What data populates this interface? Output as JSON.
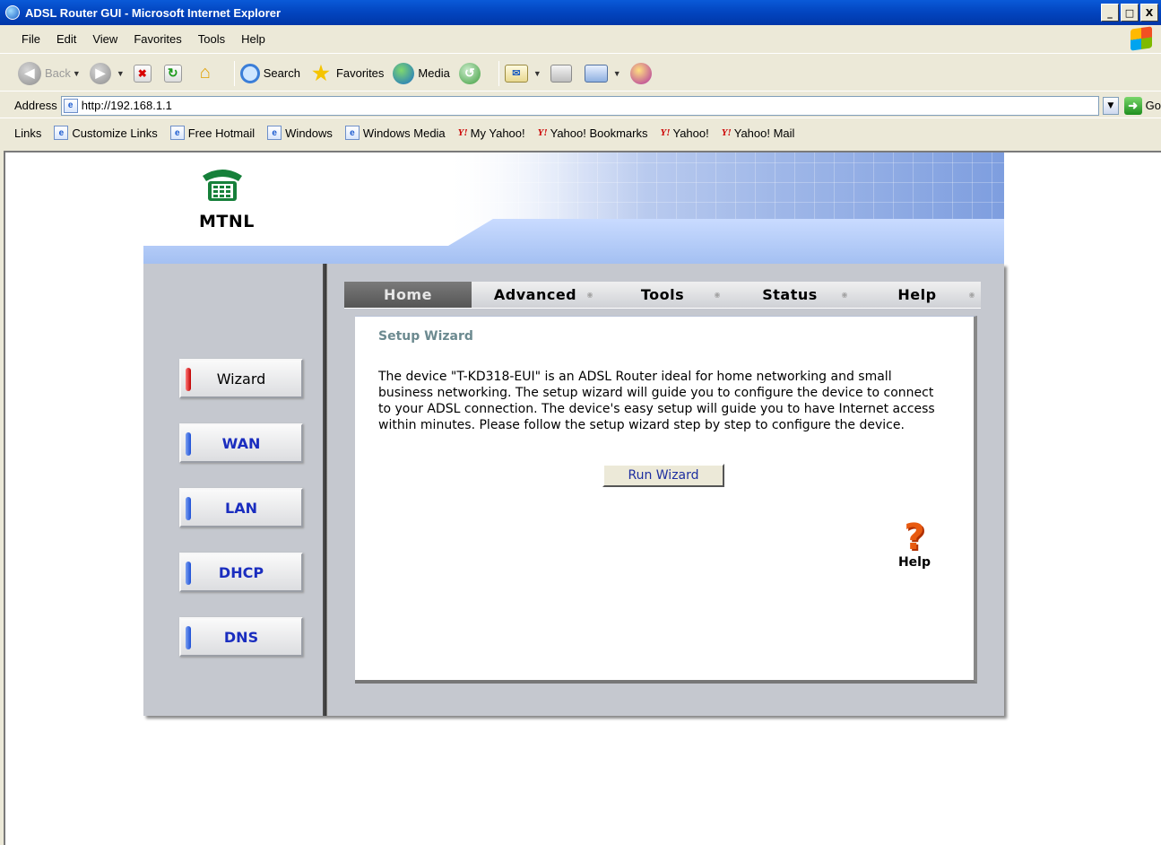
{
  "window": {
    "title": "ADSL Router GUI - Microsoft Internet Explorer",
    "minimize": "_",
    "maximize": "□",
    "close": "X"
  },
  "menu": {
    "items": [
      {
        "label": "File"
      },
      {
        "label": "Edit"
      },
      {
        "label": "View"
      },
      {
        "label": "Favorites"
      },
      {
        "label": "Tools"
      },
      {
        "label": "Help"
      }
    ]
  },
  "toolbar": {
    "back": "Back",
    "search": "Search",
    "favorites": "Favorites",
    "media": "Media"
  },
  "address": {
    "label": "Address",
    "url": "http://192.168.1.1",
    "go": "Go"
  },
  "links": {
    "label": "Links",
    "items": [
      {
        "label": "Customize Links",
        "icon": "ie-page-icon"
      },
      {
        "label": "Free Hotmail",
        "icon": "ie-page-icon"
      },
      {
        "label": "Windows",
        "icon": "ie-page-icon"
      },
      {
        "label": "Windows Media",
        "icon": "ie-page-icon"
      },
      {
        "label": "My Yahoo!",
        "icon": "yahoo-icon"
      },
      {
        "label": "Yahoo! Bookmarks",
        "icon": "yahoo-icon"
      },
      {
        "label": "Yahoo!",
        "icon": "yahoo-icon"
      },
      {
        "label": "Yahoo! Mail",
        "icon": "yahoo-icon"
      }
    ]
  },
  "router": {
    "logo_text": "MTNL",
    "tabs": [
      {
        "label": "Home",
        "active": true
      },
      {
        "label": "Advanced",
        "active": false
      },
      {
        "label": "Tools",
        "active": false
      },
      {
        "label": "Status",
        "active": false
      },
      {
        "label": "Help",
        "active": false
      }
    ],
    "sidebar": [
      {
        "label": "Wizard",
        "active": true
      },
      {
        "label": "WAN",
        "active": false
      },
      {
        "label": "LAN",
        "active": false
      },
      {
        "label": "DHCP",
        "active": false
      },
      {
        "label": "DNS",
        "active": false
      }
    ],
    "content": {
      "title": "Setup Wizard",
      "body": "The device \"T-KD318-EUI\" is an ADSL Router ideal for home networking and small business networking. The setup wizard will guide you to configure the device to connect to your ADSL connection. The device's easy setup will guide you to have Internet access within minutes. Please follow the setup wizard step by step to configure the device.",
      "run_button": "Run Wizard",
      "help_label": "Help"
    }
  },
  "colors": {
    "titlebar": "#0346c1",
    "frame_gray": "#c5c8cf",
    "sidebar_text": "#1a2dbf",
    "active_led": "#c00000",
    "section_title": "#6c8a90",
    "help_orange": "#e85a10"
  }
}
